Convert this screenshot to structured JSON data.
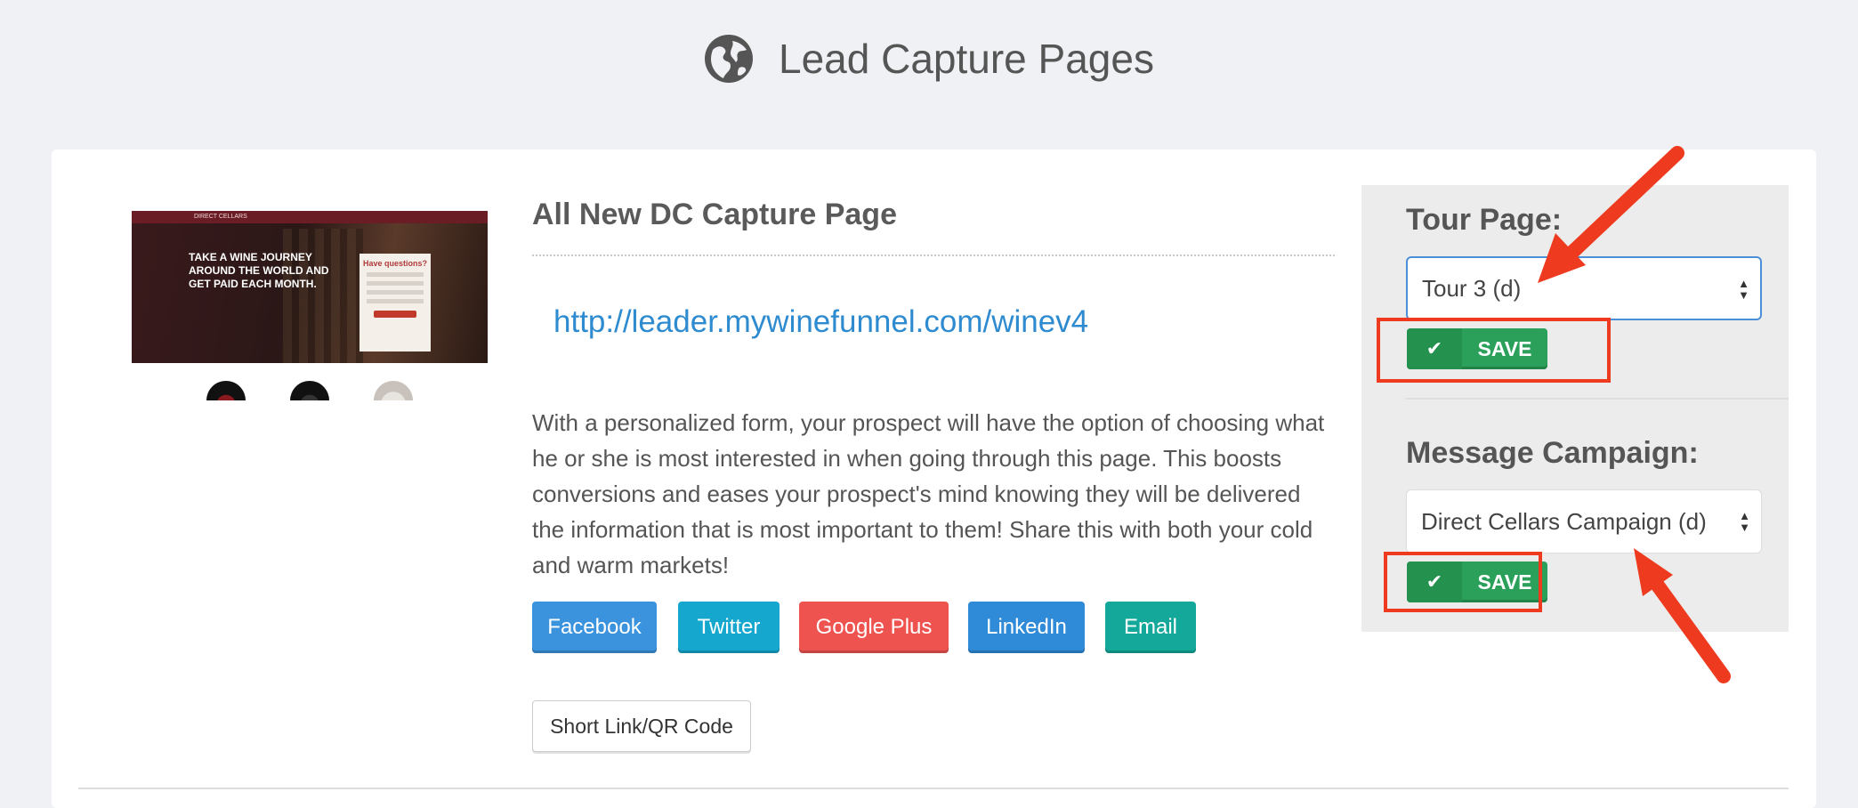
{
  "header": {
    "title": "Lead Capture Pages",
    "icon": "globe-icon"
  },
  "thumbnail": {
    "brand": "DIRECT CELLARS",
    "headline": "TAKE A WINE JOURNEY AROUND THE WORLD AND GET PAID EACH MONTH.",
    "form_title": "Have questions?"
  },
  "page": {
    "title": "All New DC Capture Page",
    "url": "http://leader.mywinefunnel.com/winev4",
    "description": "With a personalized form, your prospect will have the option of choosing what he or she is most interested in when going through this page. This boosts conversions and eases your prospect's mind knowing they will be delivered the information that is most important to them! Share this with both your cold and warm markets!",
    "share_buttons": [
      {
        "label": "Facebook",
        "color": "#3a93dc"
      },
      {
        "label": "Twitter",
        "color": "#16a7cf"
      },
      {
        "label": "Google Plus",
        "color": "#ef5350"
      },
      {
        "label": "LinkedIn",
        "color": "#2f8ad8"
      },
      {
        "label": "Email",
        "color": "#14a89a"
      }
    ],
    "short_link_label": "Short Link/QR Code"
  },
  "panel": {
    "tour_label": "Tour Page:",
    "tour_value": "Tour 3 (d)",
    "campaign_label": "Message Campaign:",
    "campaign_value": "Direct Cellars Campaign (d)",
    "save_label": "SAVE"
  },
  "colors": {
    "accent": "#2e8bcf",
    "save_green": "#2aa05a",
    "highlight_red": "#ee3b1f"
  }
}
